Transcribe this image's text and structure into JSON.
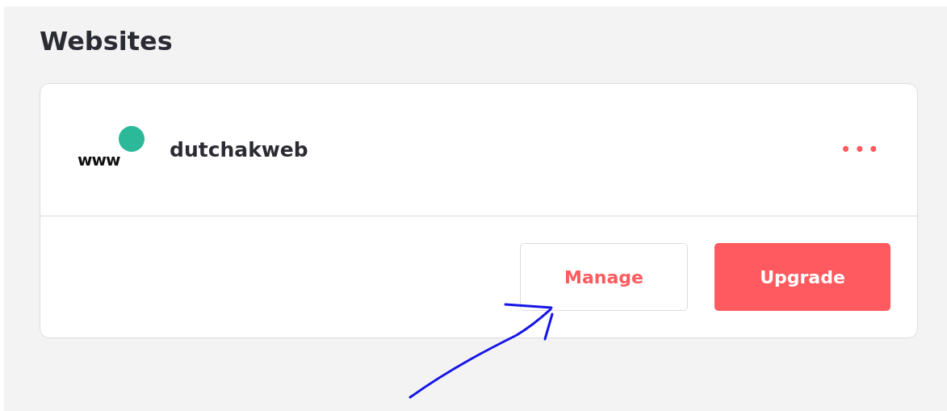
{
  "section": {
    "title": "Websites"
  },
  "websites": [
    {
      "icon_text": "www",
      "color": "#2bb99a",
      "name": "dutchakweb",
      "menu": "•••",
      "buttons": [
        {
          "label": "Manage",
          "kind": "outline"
        },
        {
          "label": "Upgrade",
          "kind": "primary"
        }
      ]
    }
  ]
}
